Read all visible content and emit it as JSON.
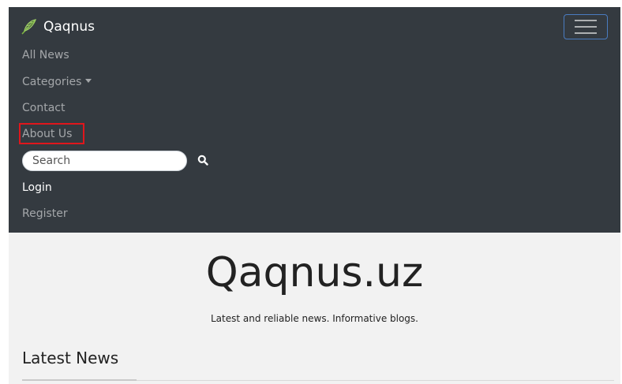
{
  "navbar": {
    "brand": {
      "name": "Qaqnus",
      "logo_icon": "feather-icon"
    },
    "toggler_icon": "hamburger-menu-icon",
    "items": [
      {
        "label": "All News",
        "active": false
      },
      {
        "label": "Categories",
        "active": false,
        "has_dropdown": true
      },
      {
        "label": "Contact",
        "active": false
      },
      {
        "label": "About Us",
        "active": false,
        "highlighted": true
      },
      {
        "label": "Login",
        "active": true
      },
      {
        "label": "Register",
        "active": false
      }
    ],
    "search": {
      "placeholder": "Search",
      "button_icon": "search-icon"
    }
  },
  "hero": {
    "title": "Qaqnus.uz",
    "subtitle": "Latest and reliable news. Informative blogs."
  },
  "latest_news": {
    "heading": "Latest News"
  },
  "colors": {
    "navbar_bg": "#343a40",
    "page_bg": "#f2f2f2",
    "highlight_border": "#e0161c",
    "toggler_border": "#4a7cc0",
    "logo_green": "#8bc34a"
  }
}
